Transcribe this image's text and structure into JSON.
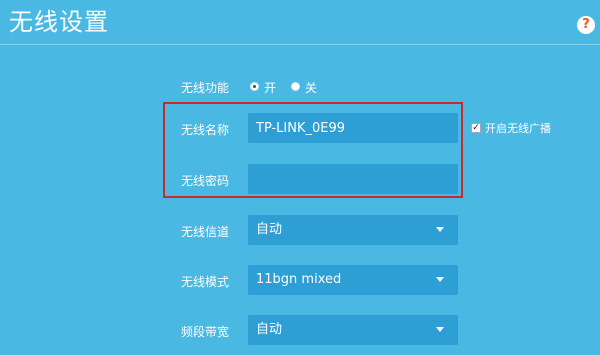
{
  "header": {
    "title": "无线设置",
    "help_glyph": "?"
  },
  "wireless_function": {
    "label": "无线功能",
    "options": [
      {
        "label": "开",
        "selected": true
      },
      {
        "label": "关",
        "selected": false
      }
    ]
  },
  "ssid": {
    "label": "无线名称",
    "value": "TP-LINK_0E99",
    "broadcast_label": "开启无线广播",
    "broadcast_checked": true
  },
  "password": {
    "label": "无线密码",
    "value": ""
  },
  "channel": {
    "label": "无线信道",
    "value": "自动"
  },
  "mode": {
    "label": "无线模式",
    "value": "11bgn mixed"
  },
  "bandwidth": {
    "label": "频段带宽",
    "value": "自动"
  },
  "colors": {
    "background": "#49b8e3",
    "field": "#2e9fd4",
    "highlight": "#cc2a2a",
    "help_icon": "#e8581d"
  }
}
